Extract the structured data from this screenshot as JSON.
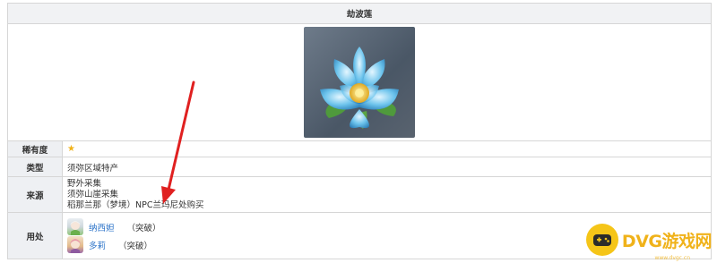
{
  "item": {
    "name": "劫波莲"
  },
  "labels": {
    "rarity": "稀有度",
    "type": "类型",
    "source": "来源",
    "usage": "用处"
  },
  "rarity_stars": "★",
  "type_value": "须弥区域特产",
  "sources": [
    "野外采集",
    "须弥山崖采集",
    "稻那兰那（梦境）NPC兰玛尼处购买"
  ],
  "usage": [
    {
      "name": "纳西妲",
      "note": "（突破）"
    },
    {
      "name": "多莉",
      "note": "（突破）"
    }
  ],
  "watermark": {
    "brand": "DVG游戏网",
    "url": "www.dvgc.cn"
  },
  "colors": {
    "link": "#2a72c8",
    "star": "#f0b21a",
    "arrow": "#e02020"
  }
}
